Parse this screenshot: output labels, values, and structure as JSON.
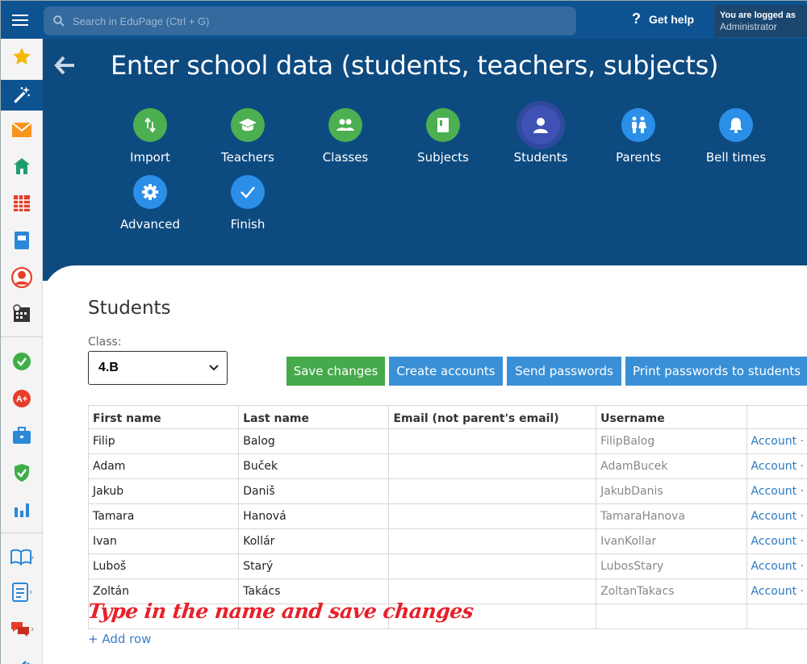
{
  "header": {
    "search_placeholder": "Search in EduPage (Ctrl + G)",
    "help_label": "Get help",
    "user_line1": "You are logged as",
    "user_line2": "Administrator",
    "brand_color": "#0d5291"
  },
  "sidebar": {
    "items": [
      {
        "icon": "star-icon",
        "color": "#f5b800"
      },
      {
        "icon": "magic-wand-icon",
        "color": "#ffffff",
        "active": true
      },
      {
        "icon": "envelope-icon",
        "color": "#f7941d"
      },
      {
        "icon": "school-icon",
        "color": "#1e9e6e"
      },
      {
        "icon": "timetable-icon",
        "color": "#e63e2a"
      },
      {
        "icon": "notebook-icon",
        "color": "#2b88d8"
      },
      {
        "icon": "user-icon",
        "color": "#e63e2a"
      },
      {
        "icon": "calendar-icon",
        "color": "#333333"
      },
      {
        "icon": "check-badge-icon",
        "color": "#3fae49"
      },
      {
        "icon": "grade-icon",
        "color": "#e63e2a"
      },
      {
        "icon": "briefcase-icon",
        "color": "#2b88d8"
      },
      {
        "icon": "shield-icon",
        "color": "#3fae49"
      },
      {
        "icon": "bar-chart-icon",
        "color": "#2b88d8"
      },
      {
        "icon": "book-icon",
        "color": "#2b88d8"
      },
      {
        "icon": "document-icon",
        "color": "#2b88d8"
      },
      {
        "icon": "chat-icon",
        "color": "#e63e2a"
      }
    ]
  },
  "hero": {
    "title": "Enter school data (students, teachers, subjects)",
    "steps": [
      {
        "label": "Import",
        "color": "green",
        "icon": "import-icon"
      },
      {
        "label": "Teachers",
        "color": "green",
        "icon": "graduation-cap-icon"
      },
      {
        "label": "Classes",
        "color": "green",
        "icon": "group-icon"
      },
      {
        "label": "Subjects",
        "color": "green",
        "icon": "book-icon"
      },
      {
        "label": "Students",
        "color": "purple",
        "icon": "student-icon"
      },
      {
        "label": "Parents",
        "color": "blue",
        "icon": "parents-icon"
      },
      {
        "label": "Bell times",
        "color": "blue",
        "icon": "bell-icon"
      },
      {
        "label": "Advanced",
        "color": "blue",
        "icon": "gear-icon"
      },
      {
        "label": "Finish",
        "color": "blue",
        "icon": "check-icon"
      }
    ]
  },
  "main": {
    "section_title": "Students",
    "class_label": "Class:",
    "class_value": "4.B",
    "buttons": {
      "save": "Save changes",
      "create": "Create accounts",
      "send": "Send passwords",
      "print": "Print passwords to students"
    },
    "table": {
      "headers": [
        "First name",
        "Last name",
        "Email (not parent's email)",
        "Username",
        ""
      ],
      "rows": [
        {
          "first": "Filip",
          "last": "Balog",
          "email": "",
          "username": "FilipBalog",
          "link": "Account ·"
        },
        {
          "first": "Adam",
          "last": "Buček",
          "email": "",
          "username": "AdamBucek",
          "link": "Account ·"
        },
        {
          "first": "Jakub",
          "last": "Daniš",
          "email": "",
          "username": "JakubDanis",
          "link": "Account ·"
        },
        {
          "first": "Tamara",
          "last": "Hanová",
          "email": "",
          "username": "TamaraHanova",
          "link": "Account ·"
        },
        {
          "first": "Ivan",
          "last": "Kollár",
          "email": "",
          "username": "IvanKollar",
          "link": "Account ·"
        },
        {
          "first": "Luboš",
          "last": "Starý",
          "email": "",
          "username": "LubosStary",
          "link": "Account ·"
        },
        {
          "first": "Zoltán",
          "last": "Takács",
          "email": "",
          "username": "ZoltanTakacs",
          "link": "Account ·"
        }
      ]
    },
    "annotation": "Type in the name and save changes",
    "add_row": "+ Add row"
  }
}
